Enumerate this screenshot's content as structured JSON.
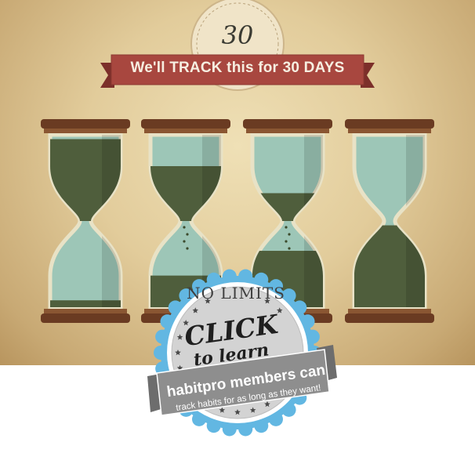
{
  "seal": {
    "number": "30"
  },
  "banner": {
    "text": "We'll TRACK this for 30 DAYS"
  },
  "hourglasses": [
    {
      "label": "day-1",
      "progress": 0.0
    },
    {
      "label": "day-10",
      "progress": 0.33
    },
    {
      "label": "day-20",
      "progress": 0.66
    },
    {
      "label": "day-30",
      "progress": 1.0
    }
  ],
  "badge": {
    "top_text": "NO LIMITS",
    "cta": "CLICK",
    "cta_sub": "to learn",
    "ribbon_line1": "habitpro members can",
    "ribbon_line2": "track habits for as long as they want!"
  },
  "colors": {
    "paper": "#e6d1a4",
    "banner_red": "#a8473f",
    "banner_dark": "#7c2f2a",
    "wood": "#6a3b22",
    "glass_light": "#9dc6b7",
    "sand_green": "#4f5e3c",
    "badge_blue": "#62b7e2",
    "ribbon_gray": "#8e8e8e"
  }
}
